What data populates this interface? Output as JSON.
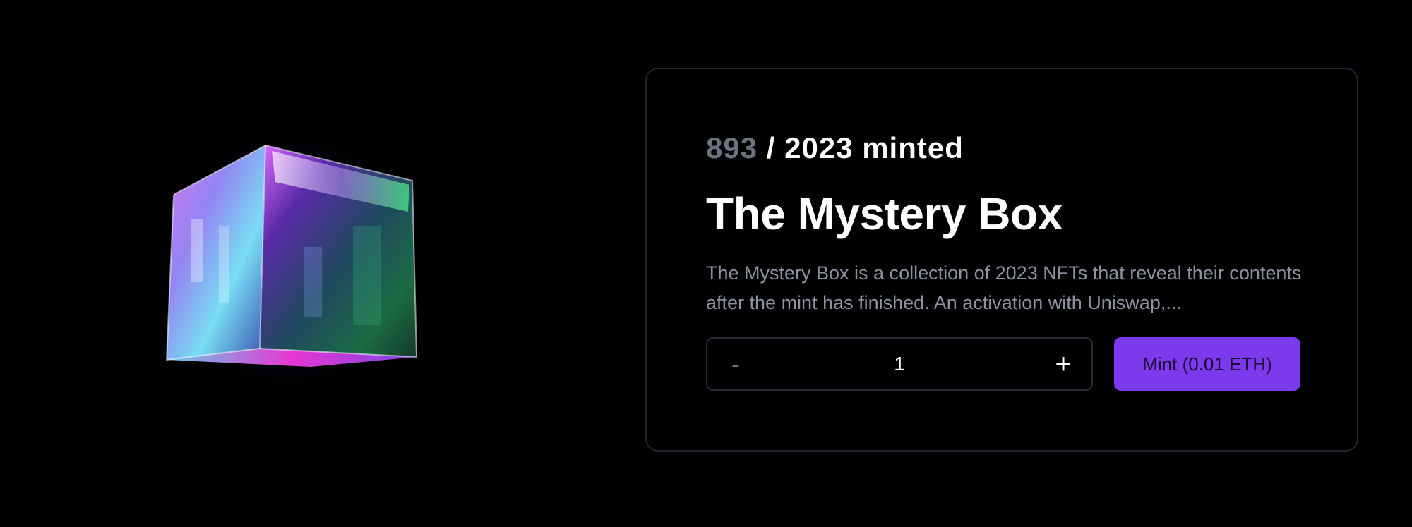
{
  "hero": {
    "image_name": "mystery-box-cube",
    "colors": [
      "#ff4fe0",
      "#4dffa0",
      "#6fe3ff",
      "#2a1f66"
    ]
  },
  "mint_card": {
    "minted_count": "893",
    "minted_suffix": "/ 2023 minted",
    "title": "The Mystery Box",
    "description": "The Mystery Box is a collection of 2023 NFTs that reveal their contents after the mint has finished. An activation with Uniswap,...",
    "quantity": {
      "decrement_label": "-",
      "value": "1",
      "increment_label": "+"
    },
    "mint_button_label": "Mint (0.01 ETH)",
    "accent_color": "#7c3aed"
  }
}
